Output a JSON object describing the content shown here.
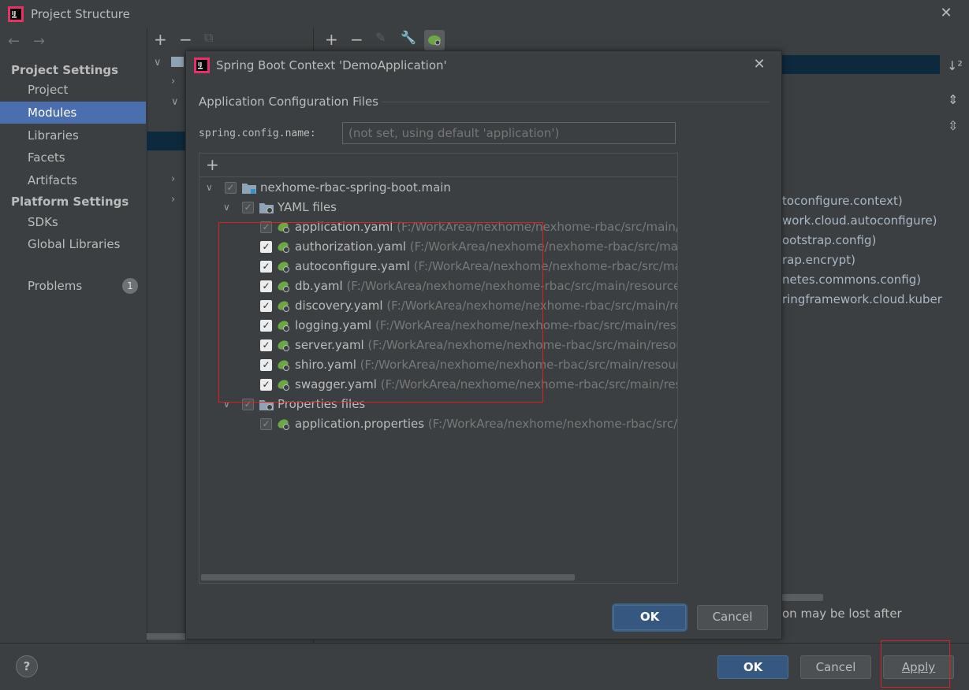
{
  "window": {
    "title": "Project Structure",
    "close_icon": "close-icon"
  },
  "sidebar": {
    "project_settings_header": "Project Settings",
    "project_items": [
      "Project",
      "Modules",
      "Libraries",
      "Facets",
      "Artifacts"
    ],
    "selected": "Modules",
    "platform_settings_header": "Platform Settings",
    "platform_items": [
      "SDKs",
      "Global Libraries"
    ],
    "problems_label": "Problems",
    "problems_count": "1"
  },
  "background_text": {
    "lines": [
      "toconfigure.context)",
      "work.cloud.autoconfigure)",
      "ootstrap.config)",
      "rap.encrypt)",
      "netes.commons.config)",
      "ringframework.cloud.kuber"
    ],
    "warning": "on may be lost after"
  },
  "dialog": {
    "title": "Spring Boot Context 'DemoApplication'",
    "section_title": "Application Configuration Files",
    "config_name_label": "spring.config.name:",
    "config_name_placeholder": "(not set, using default 'application')",
    "add_symbol": "+",
    "tree": {
      "root": "nexhome-rbac-spring-boot.main",
      "yaml_group": "YAML files",
      "yaml_files": [
        {
          "name": "application.yaml",
          "path": "(F:/WorkArea/nexhome/nexhome-rbac/src/main/r",
          "checked": "partial"
        },
        {
          "name": "authorization.yaml",
          "path": "(F:/WorkArea/nexhome/nexhome-rbac/src/main",
          "checked": "on"
        },
        {
          "name": "autoconfigure.yaml",
          "path": "(F:/WorkArea/nexhome/nexhome-rbac/src/mai",
          "checked": "on"
        },
        {
          "name": "db.yaml",
          "path": "(F:/WorkArea/nexhome/nexhome-rbac/src/main/resource",
          "checked": "on"
        },
        {
          "name": "discovery.yaml",
          "path": "(F:/WorkArea/nexhome/nexhome-rbac/src/main/re",
          "checked": "on"
        },
        {
          "name": "logging.yaml",
          "path": "(F:/WorkArea/nexhome/nexhome-rbac/src/main/reso",
          "checked": "on"
        },
        {
          "name": "server.yaml",
          "path": "(F:/WorkArea/nexhome/nexhome-rbac/src/main/resou",
          "checked": "on"
        },
        {
          "name": "shiro.yaml",
          "path": "(F:/WorkArea/nexhome/nexhome-rbac/src/main/resourc",
          "checked": "on"
        },
        {
          "name": "swagger.yaml",
          "path": "(F:/WorkArea/nexhome/nexhome-rbac/src/main/res",
          "checked": "on"
        }
      ],
      "properties_group": "Properties files",
      "properties_files": [
        {
          "name": "application.properties",
          "path": "(F:/WorkArea/nexhome/nexhome-rbac/src/r",
          "checked": "partial"
        }
      ]
    },
    "ok_label": "OK",
    "cancel_label": "Cancel"
  },
  "footer": {
    "help_label": "?",
    "ok_label": "OK",
    "cancel_label": "Cancel",
    "apply_label": "Apply"
  },
  "colors": {
    "background": "#3c3f41",
    "selection": "#4b6eaf",
    "primary_button": "#365880",
    "highlight_box": "#e02020",
    "spring_green": "#6ba844"
  }
}
